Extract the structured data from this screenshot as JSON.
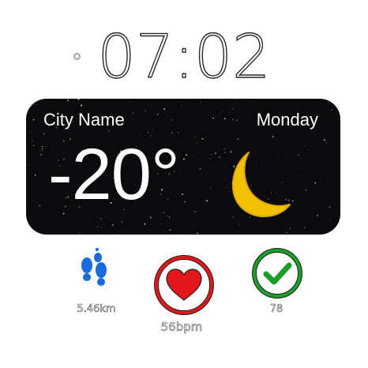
{
  "clock": {
    "time": "07:02",
    "status_indicator": "ring-icon"
  },
  "weather": {
    "city": "City Name",
    "day": "Monday",
    "temperature": "-20°",
    "condition_icon": "moon-icon",
    "card_color": "#0b0b0d"
  },
  "widgets": {
    "steps": {
      "icon": "footsteps-icon",
      "value": "5.46km",
      "color": "#1a6be0"
    },
    "heart_rate": {
      "icon": "heart-icon",
      "value": "56bpm",
      "color": "#e3161b"
    },
    "goal": {
      "icon": "checkmark-icon",
      "value": "78",
      "color": "#1b9e2c"
    }
  }
}
